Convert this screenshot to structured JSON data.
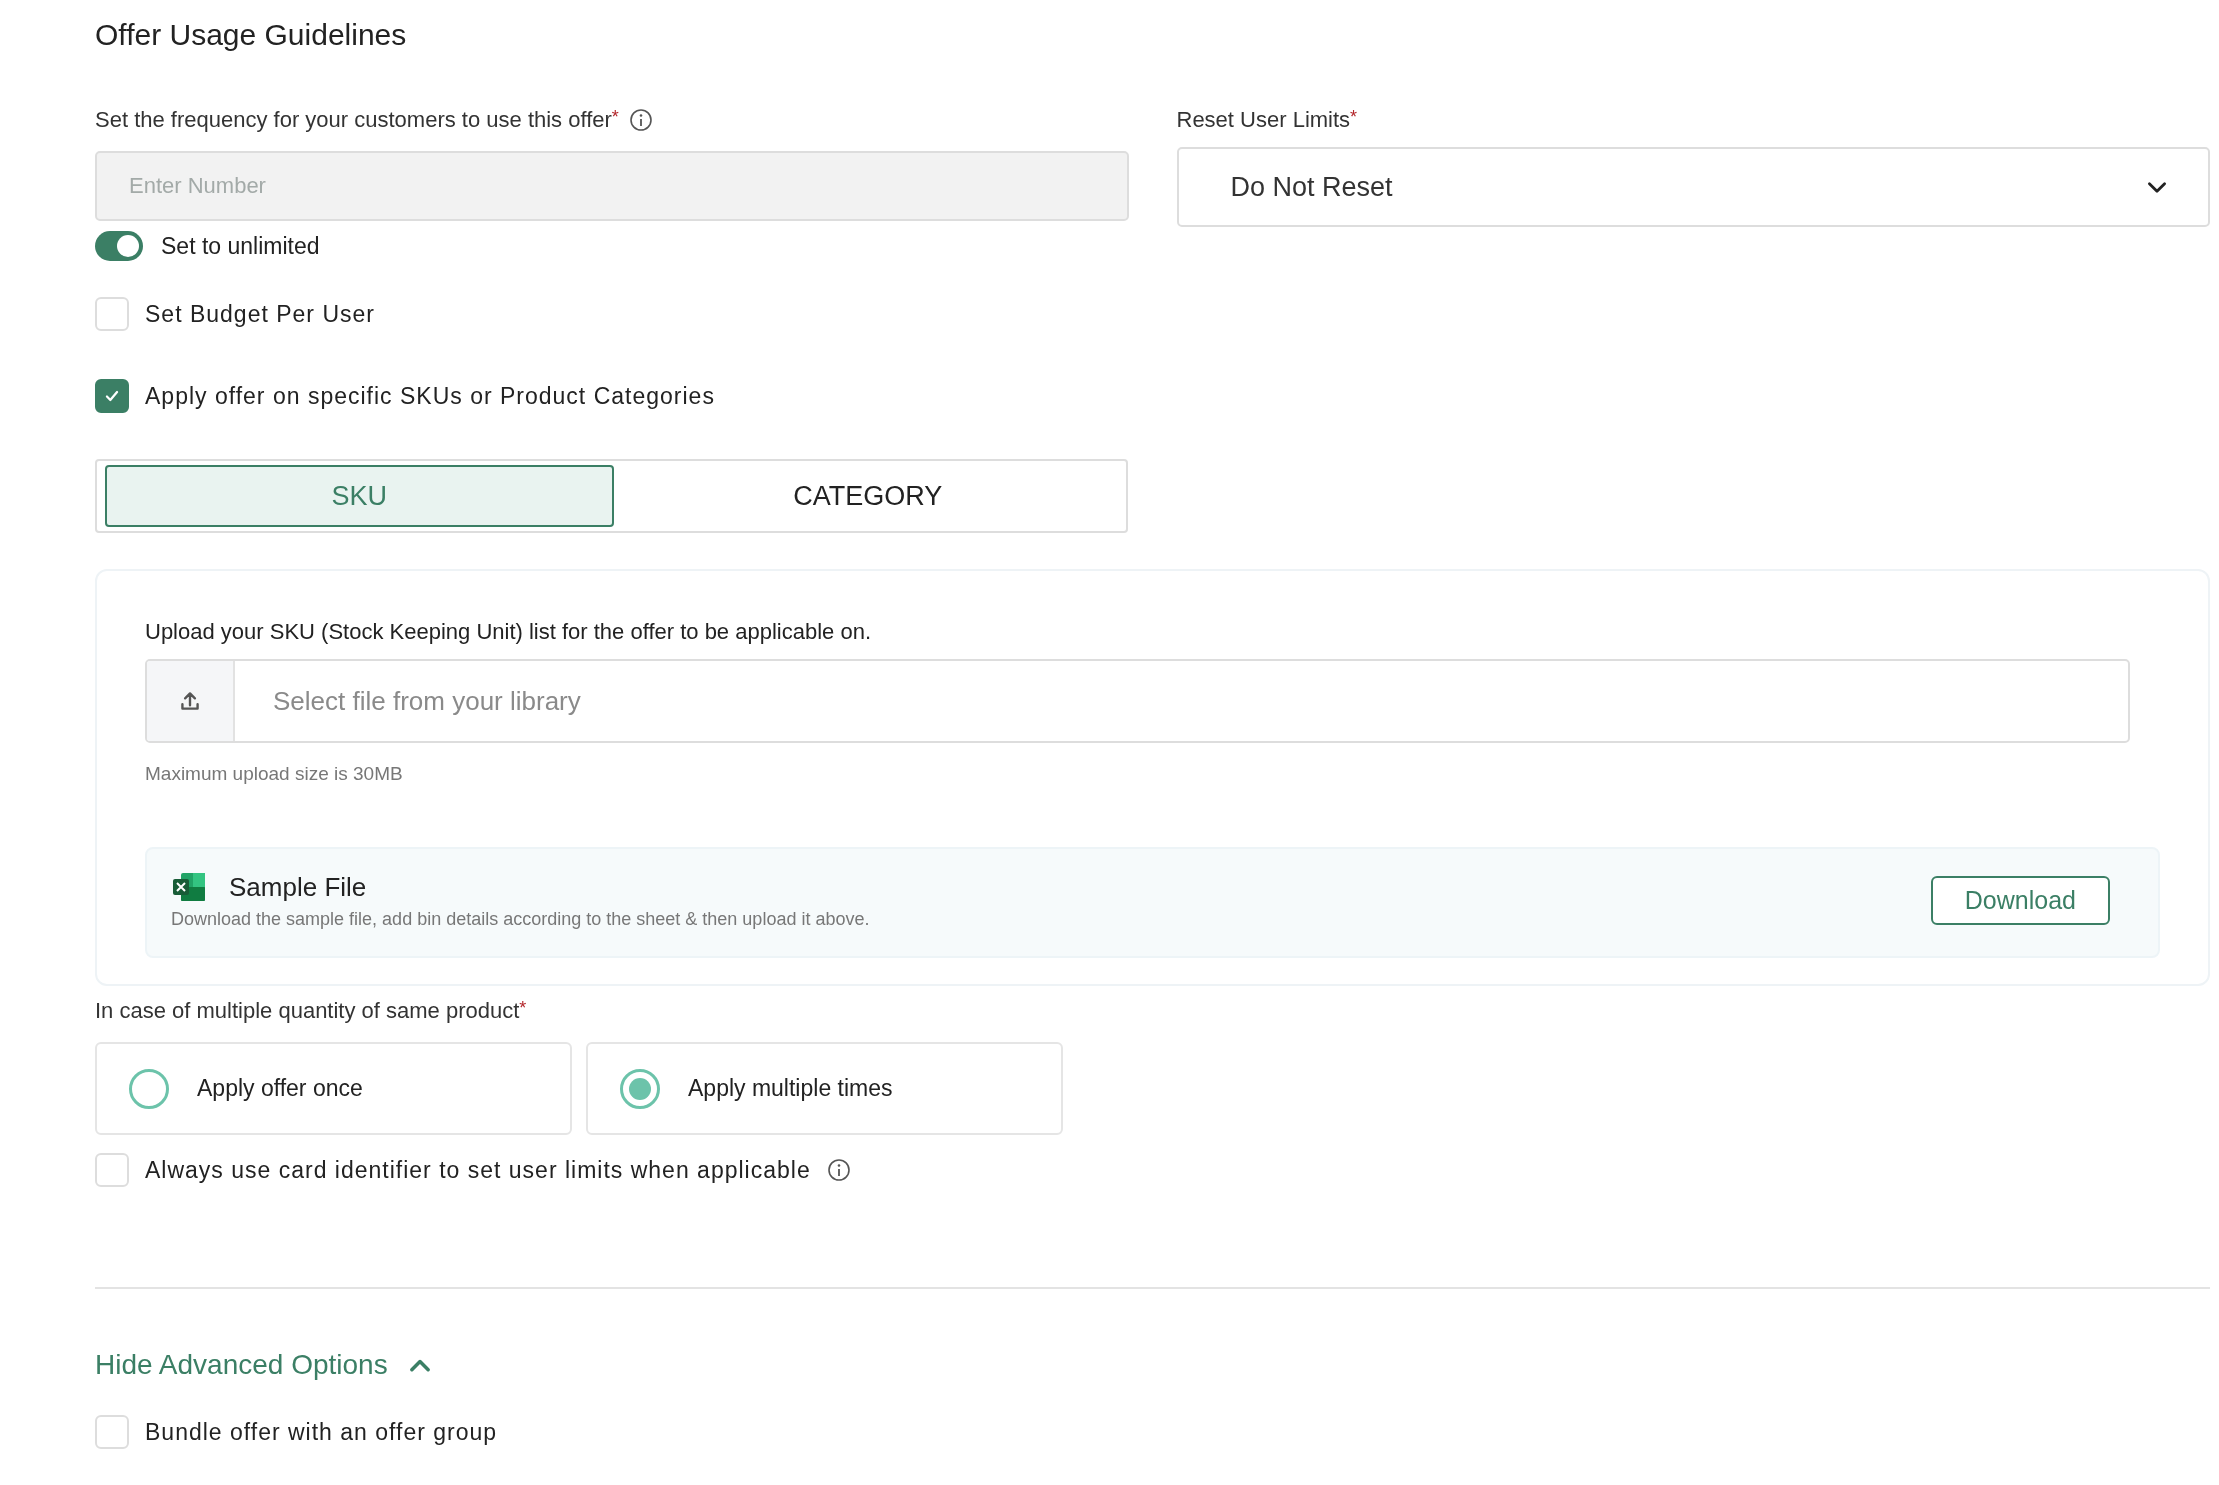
{
  "title": "Offer Usage Guidelines",
  "frequency": {
    "label": "Set the frequency for your customers to use this offer",
    "required_mark": "*",
    "placeholder": "Enter Number"
  },
  "unlimited_toggle": {
    "label": "Set to unlimited",
    "on": true
  },
  "reset_limits": {
    "label": "Reset User Limits",
    "required_mark": "*",
    "value": "Do Not Reset"
  },
  "options": [
    {
      "label": "Set Budget Per User",
      "checked": false
    },
    {
      "label": "Apply offer on specific SKUs or Product Categories",
      "checked": true
    }
  ],
  "tabs": [
    {
      "label": "SKU",
      "selected": true
    },
    {
      "label": "CATEGORY",
      "selected": false
    }
  ],
  "upload": {
    "label": "Upload your SKU (Stock Keeping Unit) list for the offer to be applicable on.",
    "placeholder": "Select file from your library",
    "hint": "Maximum upload size is 30MB"
  },
  "sample_file": {
    "title": "Sample File",
    "description": "Download the sample file, add bin details according to the sheet & then upload it above.",
    "button": "Download"
  },
  "quantity": {
    "label": "In case of multiple quantity of same product",
    "required_mark": "*",
    "choices": [
      {
        "label": "Apply offer once",
        "selected": false
      },
      {
        "label": "Apply multiple times",
        "selected": true
      }
    ]
  },
  "card_identifier": {
    "label": "Always use card identifier to set user limits when applicable",
    "checked": false
  },
  "advanced": {
    "label": "Hide Advanced Options",
    "expanded": true
  },
  "bundle": {
    "label": "Bundle offer with an offer group",
    "checked": false
  }
}
